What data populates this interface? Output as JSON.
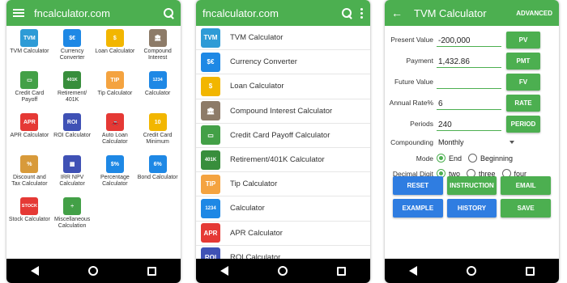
{
  "colors": {
    "primary": "#4CAF50",
    "blue_button": "#2f7de1",
    "nav": "#000000"
  },
  "phone1": {
    "title": "fncalculator.com",
    "items": [
      {
        "label": "TVM Calculator",
        "icon": "tvm-icon",
        "color": "#2e9bd6",
        "glyph": "TVM"
      },
      {
        "label": "Currency Converter",
        "icon": "currency-icon",
        "color": "#1e88e5",
        "glyph": "$€"
      },
      {
        "label": "Loan Calculator",
        "icon": "loan-house-icon",
        "color": "#f2b600",
        "glyph": "$"
      },
      {
        "label": "Compound Interest",
        "icon": "bank-icon",
        "color": "#8d7b68",
        "glyph": "🏛"
      },
      {
        "label": "Credit Card Payoff",
        "icon": "credit-card-icon",
        "color": "#43a047",
        "glyph": "▭"
      },
      {
        "label": "Retirement/ 401K",
        "icon": "retirement-icon",
        "color": "#388e3c",
        "glyph": "401K"
      },
      {
        "label": "Tip Calculator",
        "icon": "tip-icon",
        "color": "#f4a340",
        "glyph": "TIP"
      },
      {
        "label": "Calculator",
        "icon": "calculator-icon",
        "color": "#1e88e5",
        "glyph": "1234"
      },
      {
        "label": "APR Calculator",
        "icon": "apr-icon",
        "color": "#e53935",
        "glyph": "APR"
      },
      {
        "label": "ROI Calculator",
        "icon": "roi-icon",
        "color": "#3f51b5",
        "glyph": "ROI"
      },
      {
        "label": "Auto Loan Calculator",
        "icon": "car-icon",
        "color": "#e53935",
        "glyph": "🚗"
      },
      {
        "label": "Credit Card Minimum",
        "icon": "card-minimum-icon",
        "color": "#f2b600",
        "glyph": "10"
      },
      {
        "label": "Discount and Tax Calculator",
        "icon": "discount-icon",
        "color": "#d89a3a",
        "glyph": "%"
      },
      {
        "label": "IRR NPV Calculator",
        "icon": "irr-npv-icon",
        "color": "#3f51b5",
        "glyph": "▦"
      },
      {
        "label": "Percentage Calculator",
        "icon": "percentage-icon",
        "color": "#1e88e5",
        "glyph": "$%"
      },
      {
        "label": "Bond Calculator",
        "icon": "bond-icon",
        "color": "#1e88e5",
        "glyph": "6%"
      },
      {
        "label": "Stock Calculator",
        "icon": "stock-icon",
        "color": "#e53935",
        "glyph": "STOCK"
      },
      {
        "label": "Miscellaneous Calculation",
        "icon": "misc-icon",
        "color": "#43a047",
        "glyph": "÷"
      }
    ]
  },
  "phone2": {
    "title": "fncalculator.com",
    "items": [
      {
        "label": "TVM Calculator",
        "icon": "tvm-icon",
        "color": "#2e9bd6",
        "glyph": "TVM"
      },
      {
        "label": "Currency Converter",
        "icon": "currency-icon",
        "color": "#1e88e5",
        "glyph": "$€"
      },
      {
        "label": "Loan Calculator",
        "icon": "loan-house-icon",
        "color": "#f2b600",
        "glyph": "$"
      },
      {
        "label": "Compound Interest Calculator",
        "icon": "bank-icon",
        "color": "#8d7b68",
        "glyph": "🏛"
      },
      {
        "label": "Credit Card Payoff Calculator",
        "icon": "credit-card-icon",
        "color": "#43a047",
        "glyph": "▭"
      },
      {
        "label": "Retirement/401K Calculator",
        "icon": "retirement-icon",
        "color": "#388e3c",
        "glyph": "401K"
      },
      {
        "label": "Tip Calculator",
        "icon": "tip-icon",
        "color": "#f4a340",
        "glyph": "TIP"
      },
      {
        "label": "Calculator",
        "icon": "calculator-icon",
        "color": "#1e88e5",
        "glyph": "1234"
      },
      {
        "label": "APR Calculator",
        "icon": "apr-icon",
        "color": "#e53935",
        "glyph": "APR"
      },
      {
        "label": "ROI Calculator",
        "icon": "roi-icon",
        "color": "#3f51b5",
        "glyph": "ROI"
      }
    ]
  },
  "phone3": {
    "title": "TVM Calculator",
    "advanced": "ADVANCED",
    "fields": [
      {
        "label": "Present Value",
        "value": "-200,000",
        "button": "PV"
      },
      {
        "label": "Payment",
        "value": "1,432.86",
        "button": "PMT"
      },
      {
        "label": "Future Value",
        "value": "",
        "button": "FV"
      },
      {
        "label": "Annual Rate%",
        "value": "6",
        "button": "RATE"
      },
      {
        "label": "Periods",
        "value": "240",
        "button": "PERIOD"
      }
    ],
    "compounding": {
      "label": "Compounding",
      "value": "Monthly"
    },
    "mode": {
      "label": "Mode",
      "options": [
        "End",
        "Beginning"
      ],
      "selected": "End"
    },
    "decimal": {
      "label": "Decimal Digit",
      "options": [
        "two",
        "three",
        "four"
      ],
      "selected": "two"
    },
    "buttons": [
      {
        "label": "RESET",
        "style": "blue"
      },
      {
        "label": "INSTRUCTION",
        "style": "green"
      },
      {
        "label": "EMAIL",
        "style": "green"
      },
      {
        "label": "EXAMPLE",
        "style": "blue"
      },
      {
        "label": "HISTORY",
        "style": "blue"
      },
      {
        "label": "SAVE",
        "style": "green"
      }
    ]
  }
}
